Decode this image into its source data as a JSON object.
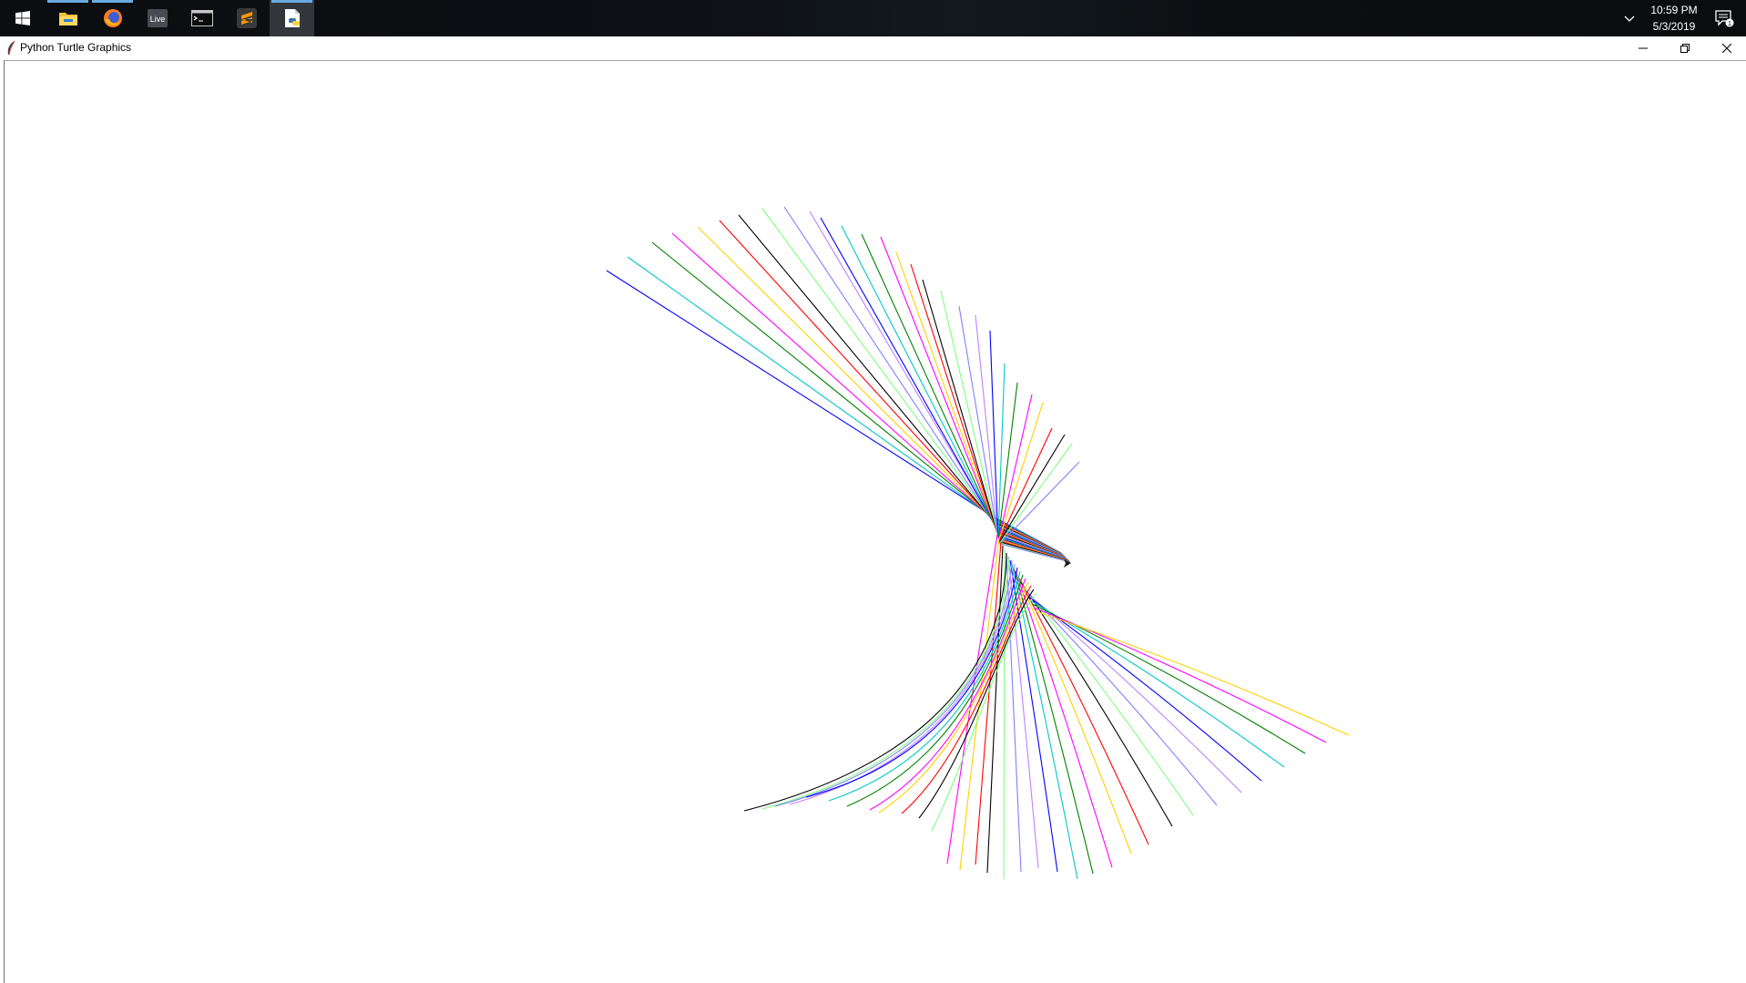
{
  "taskbar": {
    "items": [
      {
        "name": "windows-start-icon",
        "active": false,
        "running": false
      },
      {
        "name": "file-explorer-icon",
        "active": false,
        "running": true
      },
      {
        "name": "firefox-icon",
        "active": false,
        "running": true
      },
      {
        "name": "livestreamer-icon",
        "active": false,
        "running": false,
        "label": "Live"
      },
      {
        "name": "terminal-icon",
        "active": false,
        "running": false
      },
      {
        "name": "sublime-text-icon",
        "active": false,
        "running": false
      },
      {
        "name": "python-idle-icon",
        "active": true,
        "running": true
      }
    ],
    "clock": {
      "time": "10:59 PM",
      "date": "5/3/2019"
    },
    "notification_count": "1"
  },
  "window": {
    "title": "Python Turtle Graphics",
    "controls": [
      "minimize-icon",
      "restore-icon",
      "close-icon"
    ]
  },
  "turtle": {
    "colors": [
      "#0000ff",
      "#00c8c8",
      "#008000",
      "#ff00ff",
      "#ffd000",
      "#ff0000",
      "#000000",
      "#80ff80",
      "#8080ff",
      "#c080ff"
    ]
  }
}
